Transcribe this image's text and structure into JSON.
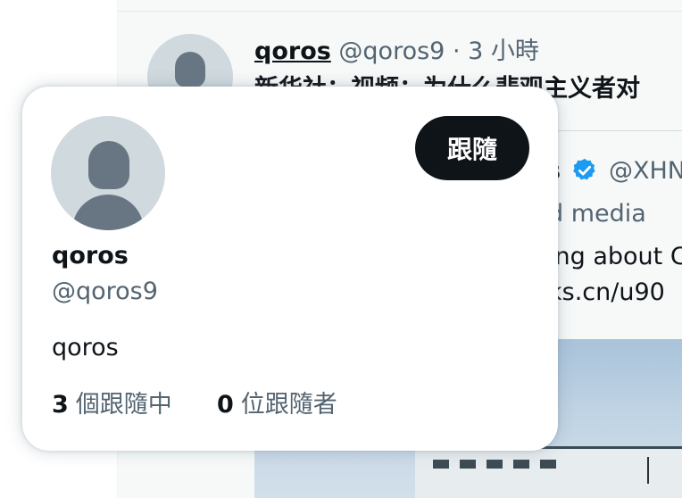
{
  "colors": {
    "text_primary": "#0f1419",
    "text_secondary": "#536471",
    "follow_button_bg": "#0f1419",
    "follow_button_text": "#ffffff",
    "verified_badge": "#1d9bf0",
    "avatar_bg": "#cfd9de",
    "avatar_fg": "#687684"
  },
  "timeline": {
    "tweet": {
      "display_name": "qoros",
      "handle": "@qoros9",
      "separator": "·",
      "time": "3 小時",
      "text": "新华社：视频：为什么悲观主义者对"
    },
    "quoted": {
      "name_fragment": "s",
      "handle_fragment": "@XHN",
      "label_fragment": "d media",
      "line1_fragment": "ing about C",
      "line2_fragment": "ks.cn/u90"
    }
  },
  "hover_card": {
    "display_name": "qoros",
    "handle": "@qoros9",
    "bio": "qoros",
    "follow_button_label": "跟隨",
    "following_count": "3",
    "following_label": "個跟隨中",
    "followers_count": "0",
    "followers_label": "位跟隨者"
  },
  "icons": [
    "default-avatar-icon",
    "verified-badge-icon"
  ]
}
